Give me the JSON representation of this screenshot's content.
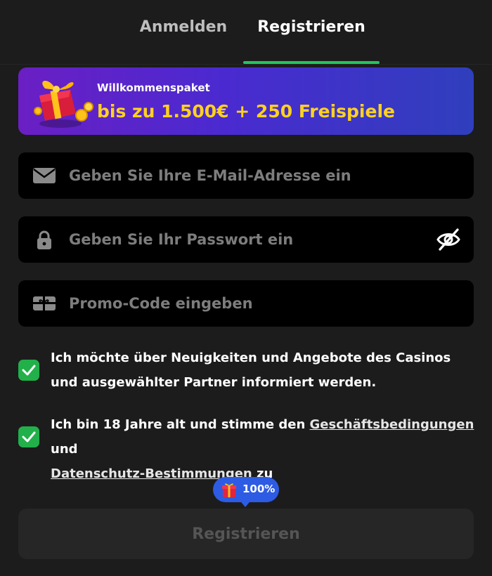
{
  "tabs": {
    "login_label": "Anmelden",
    "register_label": "Registrieren",
    "active": "register"
  },
  "banner": {
    "subtitle": "Willkommenspaket",
    "title": "bis zu 1.500€ + 250 Freispiele",
    "icon": "gift-box-icon"
  },
  "form": {
    "email": {
      "placeholder": "Geben Sie Ihre E-Mail-Adresse ein",
      "value": "",
      "icon": "envelope-icon"
    },
    "password": {
      "placeholder": "Geben Sie Ihr Passwort ein",
      "value": "",
      "icon": "lock-icon",
      "toggle_icon": "eye-slash-icon"
    },
    "promo": {
      "placeholder": "Promo-Code eingeben",
      "value": "",
      "icon": "gift-card-icon"
    }
  },
  "consents": [
    {
      "checked": true,
      "text": "Ich möchte über Neuigkeiten und Angebote des Casinos und ausgewählter Partner informiert werden."
    },
    {
      "checked": true,
      "text_before": "Ich bin 18 Jahre alt und stimme den ",
      "link_terms": "Geschäftsbedingungen",
      "text_middle": " und ",
      "link_privacy": "Datenschutz-Bestimmungen",
      "text_after": " zu"
    }
  ],
  "progress": {
    "label": "100%",
    "value_percent": 100
  },
  "submit_label": "Registrieren",
  "colors": {
    "background": "#1c1c1c",
    "accent_green": "#22c55e",
    "checkbox_green": "#22b04a",
    "banner_gold": "#ffd21f",
    "bubble_blue": "#2d5be3"
  }
}
